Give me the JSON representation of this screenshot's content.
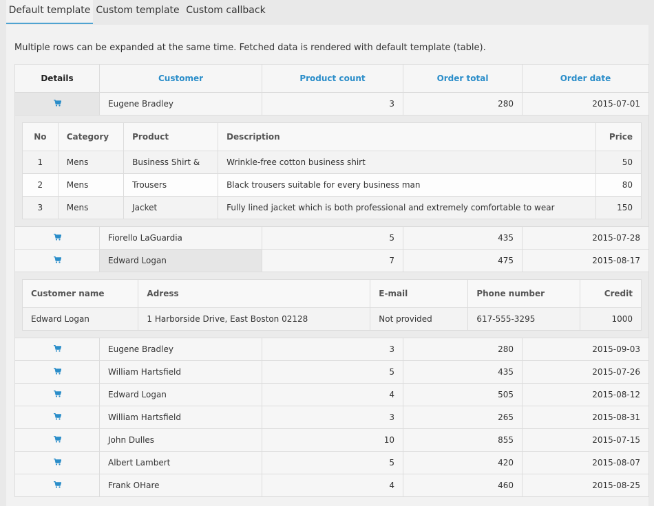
{
  "tabs": [
    "Default template",
    "Custom template",
    "Custom callback"
  ],
  "description": "Multiple rows can be expanded at the same time. Fetched data is rendered with default template (table).",
  "colors": {
    "accent": "#2a8dc9",
    "tab_underline": "#4fa3d1"
  },
  "grid": {
    "headers": [
      "Details",
      "Customer",
      "Product count",
      "Order total",
      "Order date"
    ],
    "rows": [
      {
        "customer": "Eugene Bradley",
        "count": "3",
        "total": "280",
        "date": "2015-07-01"
      },
      {
        "customer": "Fiorello LaGuardia",
        "count": "5",
        "total": "435",
        "date": "2015-07-28"
      },
      {
        "customer": "Edward Logan",
        "count": "7",
        "total": "475",
        "date": "2015-08-17"
      },
      {
        "customer": "Eugene Bradley",
        "count": "3",
        "total": "280",
        "date": "2015-09-03"
      },
      {
        "customer": "William Hartsfield",
        "count": "5",
        "total": "435",
        "date": "2015-07-26"
      },
      {
        "customer": "Edward Logan",
        "count": "4",
        "total": "505",
        "date": "2015-08-12"
      },
      {
        "customer": "William Hartsfield",
        "count": "3",
        "total": "265",
        "date": "2015-08-31"
      },
      {
        "customer": "John Dulles",
        "count": "10",
        "total": "855",
        "date": "2015-07-15"
      },
      {
        "customer": "Albert Lambert",
        "count": "5",
        "total": "420",
        "date": "2015-08-07"
      },
      {
        "customer": "Frank OHare",
        "count": "4",
        "total": "460",
        "date": "2015-08-25"
      }
    ]
  },
  "products_detail": {
    "headers": [
      "No",
      "Category",
      "Product",
      "Description",
      "Price"
    ],
    "rows": [
      [
        "1",
        "Mens",
        "Business Shirt &",
        "Wrinkle-free cotton business shirt",
        "50"
      ],
      [
        "2",
        "Mens",
        "Trousers",
        "Black trousers suitable for every business man",
        "80"
      ],
      [
        "3",
        "Mens",
        "Jacket",
        "Fully lined jacket which is both professional and extremely comfortable to wear",
        "150"
      ]
    ]
  },
  "customer_detail": {
    "headers": [
      "Customer name",
      "Adress",
      "E-mail",
      "Phone number",
      "Credit"
    ],
    "rows": [
      [
        "Edward Logan",
        "1 Harborside Drive, East Boston 02128",
        "Not provided",
        "617-555-3295",
        "1000"
      ]
    ]
  }
}
